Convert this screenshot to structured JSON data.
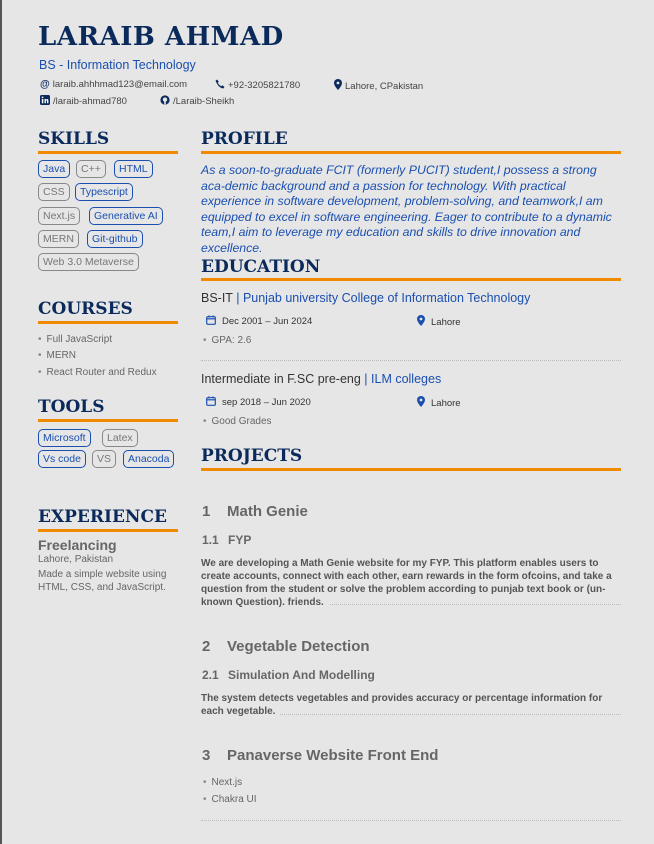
{
  "header": {
    "name": "LARAIB AHMAD",
    "role": "BS - Information Technology",
    "email": "laraib.ahhhmad123@email.com",
    "phone": "+92-3205821780",
    "location": "Lahore, CPakistan",
    "linkedin": "/laraib-ahmad780",
    "github": "/Laraib-Sheikh"
  },
  "skills": {
    "title": "SKILLS",
    "items": [
      "Java",
      "C++",
      "HTML",
      "CSS",
      "Typescript",
      "Next.js",
      "Generative AI",
      "MERN",
      "Git-github",
      "Web 3.0 Metaverse"
    ]
  },
  "courses": {
    "title": "COURSES",
    "items": [
      "Full JavaScript",
      "MERN",
      "React Router and Redux"
    ]
  },
  "tools": {
    "title": "TOOLS",
    "items": [
      "Microsoft",
      "Latex",
      "Vs code",
      "VS",
      "Anacoda"
    ]
  },
  "experience": {
    "title": "EXPERIENCE",
    "role": "Freelancing",
    "location": "Lahore, Pakistan",
    "description": "Made a simple website using HTML, CSS, and JavaScript."
  },
  "profile": {
    "title": "PROFILE",
    "text": "As a soon-to-graduate FCIT (formerly PUCIT) student,I possess a strong aca-demic background and a passion for technology. With practical experience in software development, problem-solving, and teamwork,I am equipped to excel in software engineering. Eager to contribute to a dynamic team,I aim to leverage my education and skills to drive innovation and excellence."
  },
  "education": {
    "title": "EDUCATION",
    "entries": [
      {
        "degree": "BS-IT",
        "institution": "Punjab university College of Information Technology",
        "dates": "Dec 2001 – Jun 2024",
        "location": "Lahore",
        "note": "GPA: 2.6"
      },
      {
        "degree": "Intermediate in F.SC pre-eng",
        "institution": "ILM colleges",
        "dates": "sep 2018 – Jun 2020",
        "location": "Lahore",
        "note": "Good Grades"
      }
    ]
  },
  "projects": {
    "title": "PROJECTS",
    "items": [
      {
        "num": "1",
        "name": "Math Genie",
        "sub_num": "1.1",
        "sub": "FYP",
        "desc": "We are developing a Math Genie website for my FYP. This platform enables users to create accounts, connect with each other, earn rewards in the form ofcoins, and take a question from the student or solve the problem according to punjab text book or (un-known Question). friends."
      },
      {
        "num": "2",
        "name": "Vegetable Detection",
        "sub_num": "2.1",
        "sub": "Simulation And Modelling",
        "desc": "The system detects vegetables and provides accuracy or percentage information for each vegetable."
      },
      {
        "num": "3",
        "name": "Panaverse Website Front End",
        "bullets": [
          "Next.js",
          "Chakra UI"
        ]
      }
    ]
  },
  "icons": {
    "email": "at-icon",
    "phone": "phone-icon",
    "location": "map-pin-icon",
    "linkedin": "linkedin-icon",
    "github": "github-icon",
    "calendar": "calendar-icon"
  },
  "colors": {
    "accent": "#f08a00",
    "heading": "#0b2a5c",
    "link": "#1a4fb0"
  }
}
